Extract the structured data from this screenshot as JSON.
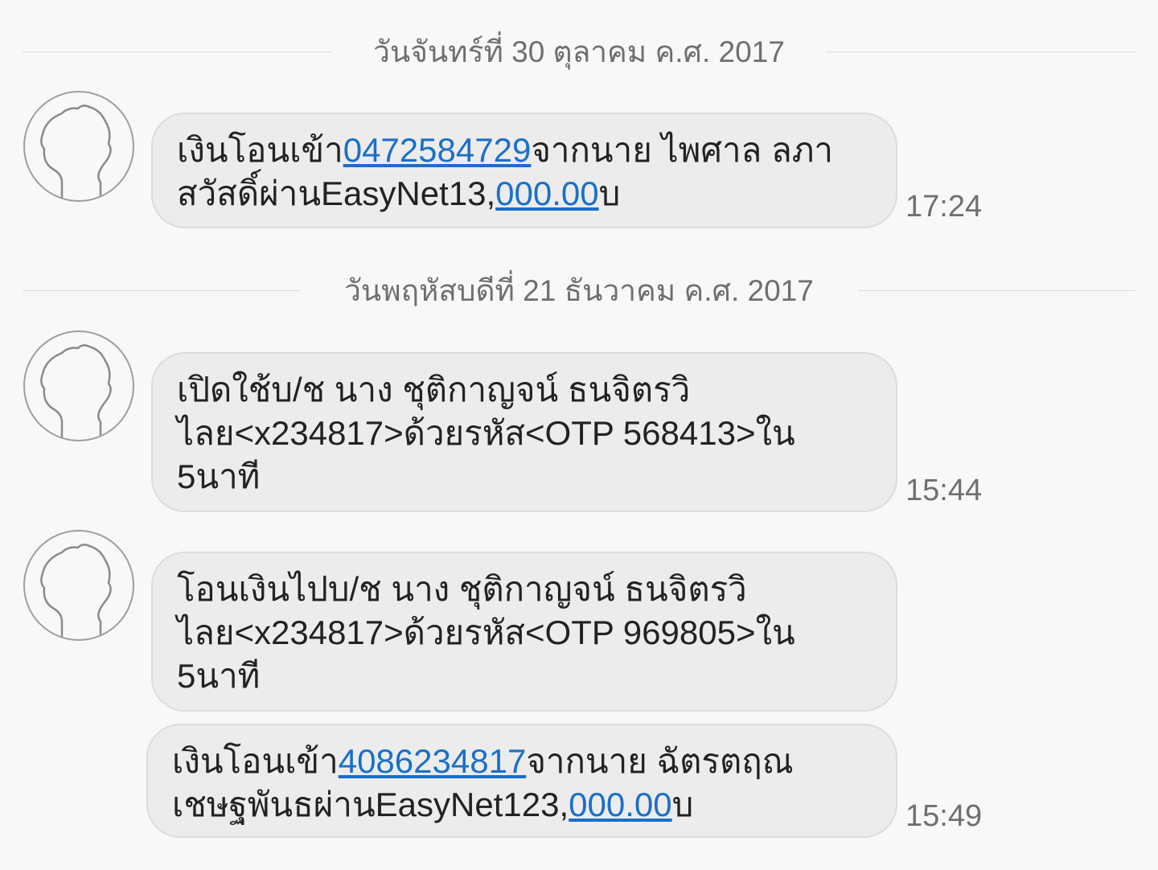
{
  "dividers": [
    {
      "label": "วันจันทร์ที่ 30 ตุลาคม ค.ศ. 2017"
    },
    {
      "label": "วันพฤหัสบดีที่ 21 ธันวาคม ค.ศ. 2017"
    }
  ],
  "messages": [
    {
      "time": "17:24",
      "text": {
        "p1": "เงินโอนเข้า",
        "link1": "0472584729",
        "p2": "จากนาย ไพศาล ลภา",
        "p3": "สวัสดิ์ผ่านEasyNet13,",
        "link2": "000.00",
        "p4": "บ"
      }
    },
    {
      "time": "15:44",
      "text": {
        "l1": "เปิดใช้บ/ช นาง ชุติกาญจน์ ธนจิตรวิ",
        "l2": "ไลย<x234817>ด้วยรหัส<OTP 568413>ใน",
        "l3": "5นาที"
      }
    },
    {
      "time": "",
      "text": {
        "l1": "โอนเงินไปบ/ช นาง ชุติกาญจน์ ธนจิตรวิ",
        "l2": "ไลย<x234817>ด้วยรหัส<OTP 969805>ใน",
        "l3": "5นาที"
      }
    },
    {
      "time": "15:49",
      "text": {
        "p1": "เงินโอนเข้า",
        "link1": "4086234817",
        "p2": "จากนาย ฉัตรตฤณ",
        "p3": "เชษฐพันธผ่านEasyNet123,",
        "link2": "000.00",
        "p4": "บ"
      }
    }
  ],
  "colors": {
    "background": "#f8f8f8",
    "bubble": "#ececec",
    "link": "#1a6fc9",
    "meta_text": "#6f6f6f"
  },
  "icons": {
    "avatar": "person-silhouette-icon"
  }
}
